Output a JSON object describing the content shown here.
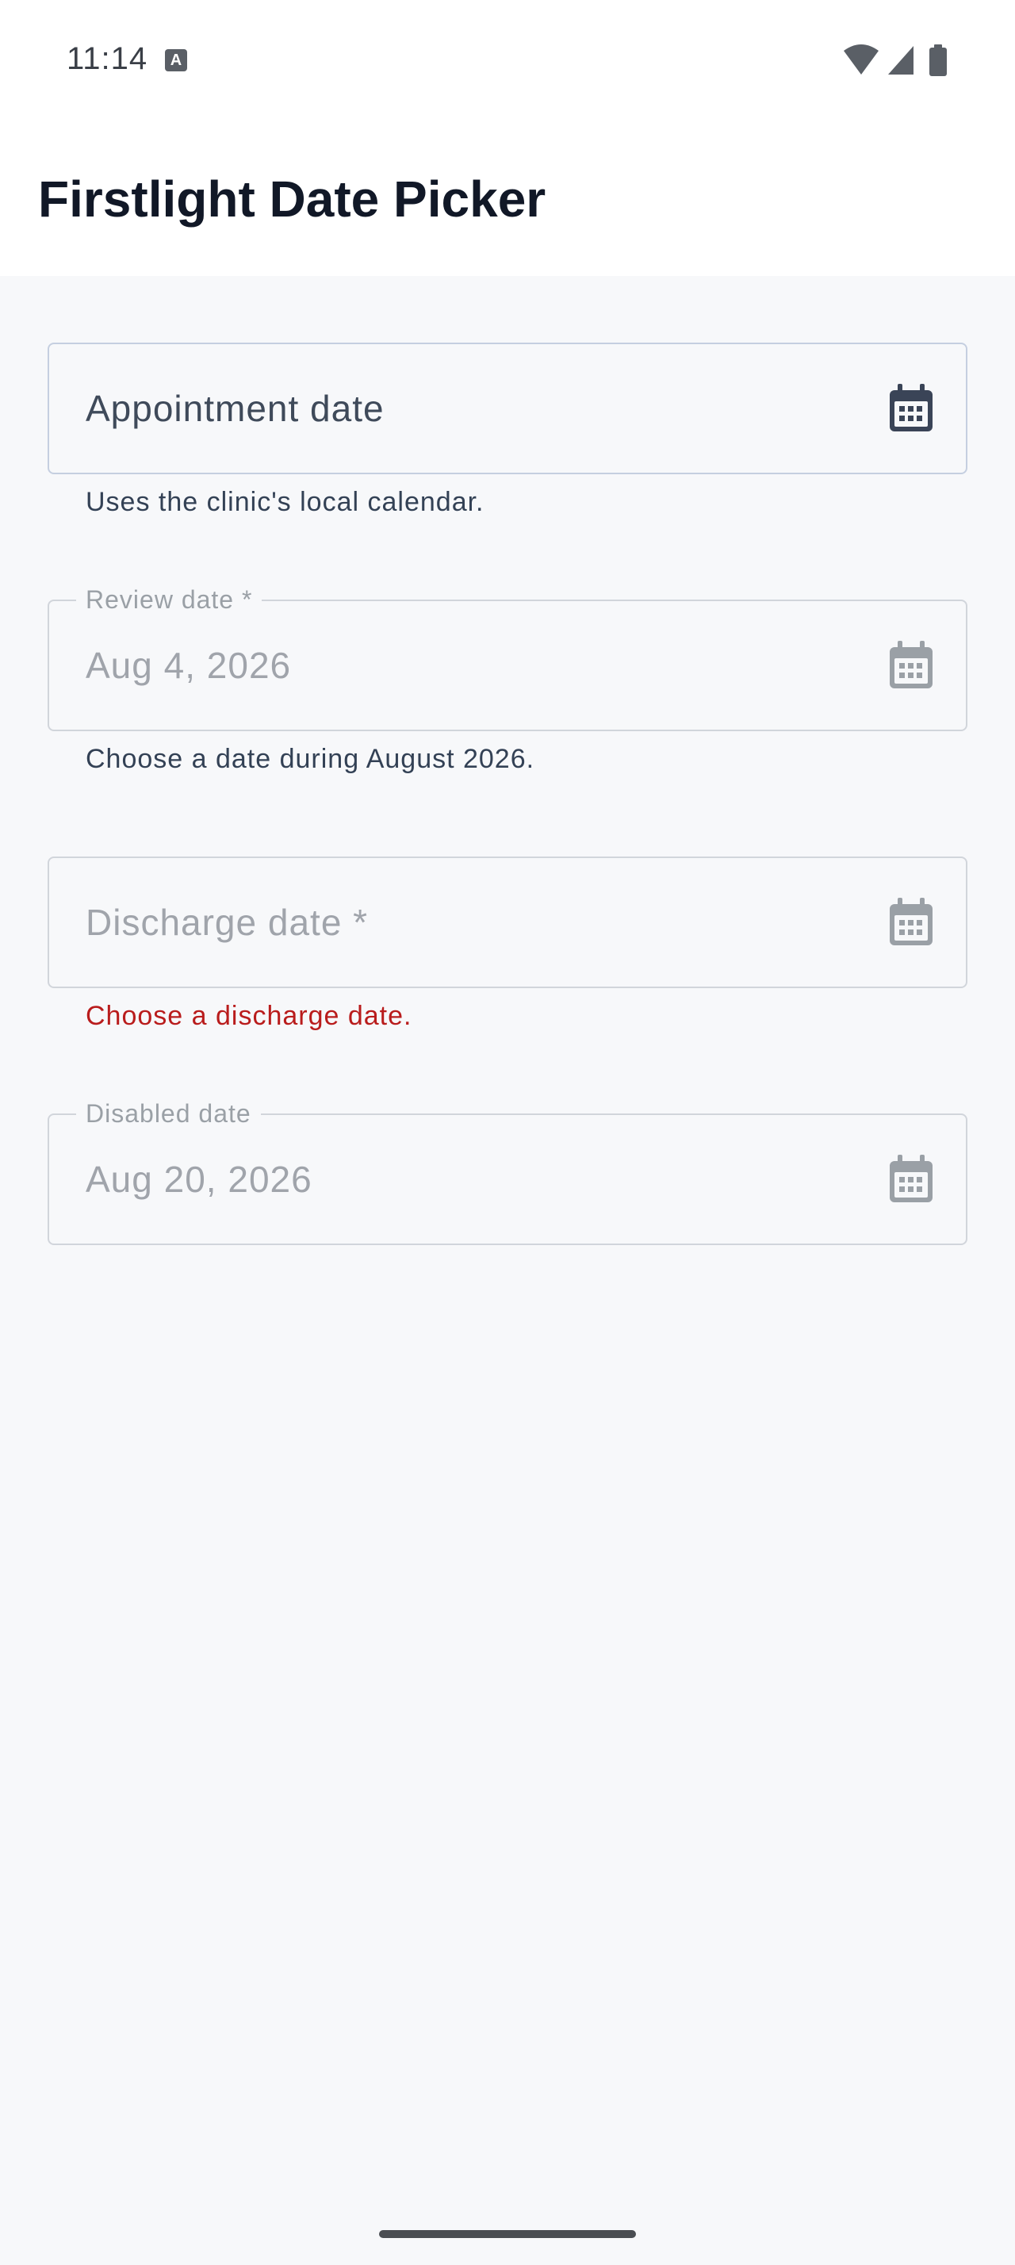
{
  "status_bar": {
    "time": "11:14",
    "notification_icon": "a-icon",
    "wifi_icon": "wifi-icon",
    "signal_icon": "cell-signal-icon",
    "battery_icon": "battery-icon"
  },
  "app_bar": {
    "title": "Firstlight Date Picker"
  },
  "fields": {
    "appointment": {
      "label": "Appointment date",
      "helper": "Uses the clinic's local calendar.",
      "icon": "calendar-icon",
      "state": "focused"
    },
    "review": {
      "floating_label": "Review date *",
      "value": "Aug 4, 2026",
      "helper": "Choose a date during August 2026.",
      "icon": "calendar-icon"
    },
    "discharge": {
      "label": "Discharge date *",
      "error": "Choose a discharge date.",
      "icon": "calendar-icon"
    },
    "disabled": {
      "floating_label": "Disabled date",
      "value": "Aug 20, 2026",
      "icon": "calendar-icon",
      "state": "disabled"
    }
  },
  "colors": {
    "title": "#111827",
    "error": "#b91c1c",
    "icon_active": "#3a4457",
    "icon_muted": "#9aa0a6"
  }
}
